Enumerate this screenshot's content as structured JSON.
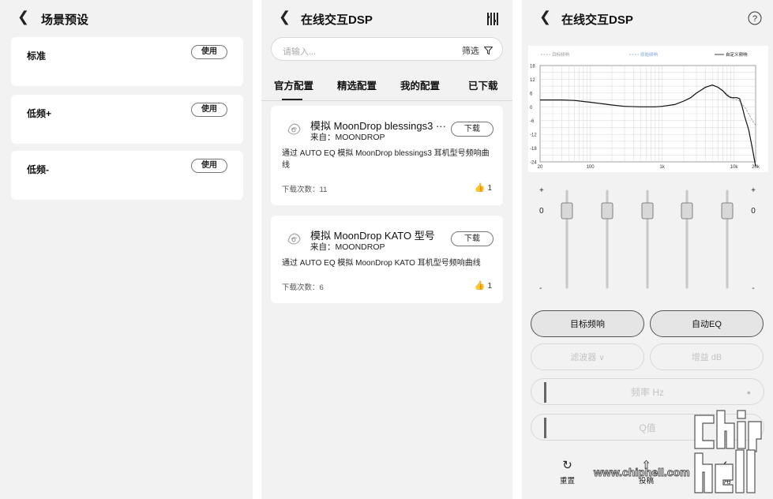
{
  "scene_preset": {
    "title": "场景预设",
    "back_icon": "chevron-left-icon",
    "items": [
      {
        "name": "标准",
        "button": "使用"
      },
      {
        "name": "低频+",
        "button": "使用"
      },
      {
        "name": "低频-",
        "button": "使用"
      }
    ]
  },
  "online_dsp": {
    "title": "在线交互DSP",
    "search_placeholder": "请输入...",
    "filter_label": "筛选",
    "tabs": [
      "官方配置",
      "精选配置",
      "我的配置",
      "已下载"
    ],
    "active_tab": 0,
    "configs": [
      {
        "name": "模拟 MoonDrop blessings3 ···",
        "source": "来自：MOONDROP",
        "button": "下载",
        "description": "通过 AUTO EQ 模拟 MoonDrop blessings3 耳机型号频响曲线",
        "downloads": "下载次数：11",
        "likes": "1"
      },
      {
        "name": "模拟 MoonDrop KATO 型号",
        "source": "来自：MOONDROP",
        "button": "下载",
        "description": "通过 AUTO EQ 模拟 MoonDrop KATO 耳机型号频响曲线",
        "downloads": "下载次数：6",
        "likes": "1"
      }
    ]
  },
  "eq_screen": {
    "title": "在线交互DSP",
    "help_icon": "question-circle-icon",
    "legend": [
      "目标频响",
      "原始频响",
      "自定义频响"
    ],
    "colors": {
      "target": "#999999",
      "original": "#7aa6d6",
      "custom": "#111111"
    },
    "slider_plus": "+",
    "slider_minus": "-",
    "gain_left": "0",
    "gain_right": "0",
    "slider_levels": [
      0,
      0,
      0,
      0,
      0
    ],
    "btn_target": "目标频响",
    "btn_auto_eq": "自动EQ",
    "filter_select": "滤波器",
    "gain_field": "增益  dB",
    "freq_field": "频率  Hz",
    "q_field": "Q值",
    "actions": {
      "reset": "重置",
      "submit": "投稿",
      "apply": "应用"
    }
  },
  "chart_data": {
    "type": "line",
    "x_scale": "log",
    "xlim": [
      20,
      20000
    ],
    "ylim": [
      -24,
      18
    ],
    "x_ticks": [
      "20",
      "100",
      "1k",
      "10k",
      "20k"
    ],
    "x_tick_values": [
      20,
      100,
      1000,
      10000,
      20000
    ],
    "y_ticks": [
      "18",
      "12",
      "6",
      "0",
      "-6",
      "-12",
      "-18",
      "-24"
    ],
    "y_tick_values": [
      18,
      12,
      6,
      0,
      -6,
      -12,
      -18,
      -24
    ],
    "grid": true,
    "legend_position": "top",
    "series": [
      {
        "name": "自定义频响",
        "style": "solid",
        "x": [
          20,
          40,
          60,
          100,
          150,
          200,
          300,
          500,
          800,
          1000,
          1500,
          2000,
          2500,
          3000,
          4000,
          5000,
          6000,
          7000,
          8000,
          9000,
          10000,
          11000,
          12000,
          13000,
          14000,
          16000,
          18000,
          20000
        ],
        "y": [
          3,
          3,
          2.8,
          2,
          1.3,
          0.8,
          0.2,
          0,
          0,
          0.2,
          1,
          2.5,
          4,
          6,
          8.5,
          9.5,
          8.5,
          7,
          5,
          4,
          4,
          4,
          3.5,
          0,
          -4,
          -10,
          -18,
          -26
        ]
      },
      {
        "name": "目标频响",
        "style": "dashed",
        "x": [
          20,
          40,
          60,
          100,
          150,
          200,
          300,
          500,
          800,
          1000,
          1500,
          2000,
          2500,
          3000,
          4000,
          5000,
          6000,
          7000,
          8000,
          9000,
          10000,
          11000,
          12000,
          13000,
          14000,
          16000,
          18000,
          20000
        ],
        "y": [
          3,
          3,
          2.8,
          2,
          1.3,
          0.8,
          0.2,
          0,
          0,
          0.2,
          1,
          2.5,
          4,
          6,
          8.5,
          9.5,
          8.5,
          7,
          5.5,
          4.5,
          3.5,
          3,
          2.5,
          1,
          0,
          -3,
          -6,
          -8
        ]
      }
    ]
  }
}
